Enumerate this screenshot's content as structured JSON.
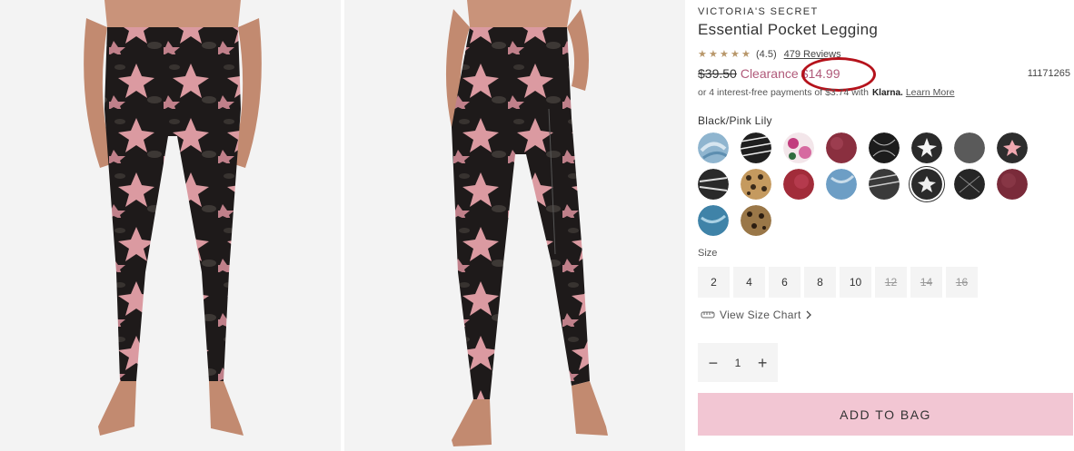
{
  "product": {
    "brand": "VICTORIA'S SECRET",
    "title": "Essential Pocket Legging",
    "rating": "(4.5)",
    "reviews": "479 Reviews",
    "old_price": "$39.50",
    "clearance_label": "Clearance",
    "sale_price": "$14.99",
    "sku": "11171265",
    "klarna_text": "or 4 interest-free payments of $3.74 with",
    "klarna_brand": "Klarna.",
    "klarna_link": "Learn More",
    "color_name": "Black/Pink Lily"
  },
  "swatches": [
    {
      "name": "swatch-blue-tie-dye",
      "color": "#8fb5cf"
    },
    {
      "name": "swatch-black-white-stripe",
      "color": "#333333"
    },
    {
      "name": "swatch-pink-floral",
      "color": "#e7b9cc"
    },
    {
      "name": "swatch-burgundy",
      "color": "#8a2f3f"
    },
    {
      "name": "swatch-black-pattern",
      "color": "#222222"
    },
    {
      "name": "swatch-black-pink-floral",
      "color": "#2a2a2a"
    },
    {
      "name": "swatch-charcoal",
      "color": "#5a5a5a"
    },
    {
      "name": "swatch-black-pink-lily",
      "color": "#2d2d2d"
    },
    {
      "name": "swatch-black-white-abstract",
      "color": "#3a3a3a"
    },
    {
      "name": "swatch-leopard",
      "color": "#b98a50"
    },
    {
      "name": "swatch-red-tie-dye",
      "color": "#a22c3a"
    },
    {
      "name": "swatch-blue-marble",
      "color": "#6d9ec5"
    },
    {
      "name": "swatch-black-grey-stripe",
      "color": "#4a4a4a"
    },
    {
      "name": "swatch-black-pink-lily-selected",
      "color": "#2a2a2a"
    },
    {
      "name": "swatch-black-print",
      "color": "#333333"
    },
    {
      "name": "swatch-maroon",
      "color": "#7a2b3a"
    },
    {
      "name": "swatch-teal-marble",
      "color": "#3f83a8"
    },
    {
      "name": "swatch-leopard-brown",
      "color": "#8a6a3f"
    }
  ],
  "size": {
    "label": "Size",
    "options": [
      {
        "label": "2",
        "available": true
      },
      {
        "label": "4",
        "available": true
      },
      {
        "label": "6",
        "available": true
      },
      {
        "label": "8",
        "available": true
      },
      {
        "label": "10",
        "available": true
      },
      {
        "label": "12",
        "available": false
      },
      {
        "label": "14",
        "available": false
      },
      {
        "label": "16",
        "available": false
      }
    ],
    "chart_link": "View Size Chart"
  },
  "quantity": {
    "value": "1",
    "minus": "−",
    "plus": "+"
  },
  "cta": {
    "add_to_bag": "ADD TO BAG"
  },
  "icons": {
    "star": "star-icon",
    "ruler": "ruler-icon",
    "chevron": "chevron-right-icon"
  },
  "colors": {
    "accent_pink": "#f2c6d3",
    "clearance": "#b05a7a",
    "annotation_circle": "#b5121b",
    "star": "#b8976a"
  }
}
